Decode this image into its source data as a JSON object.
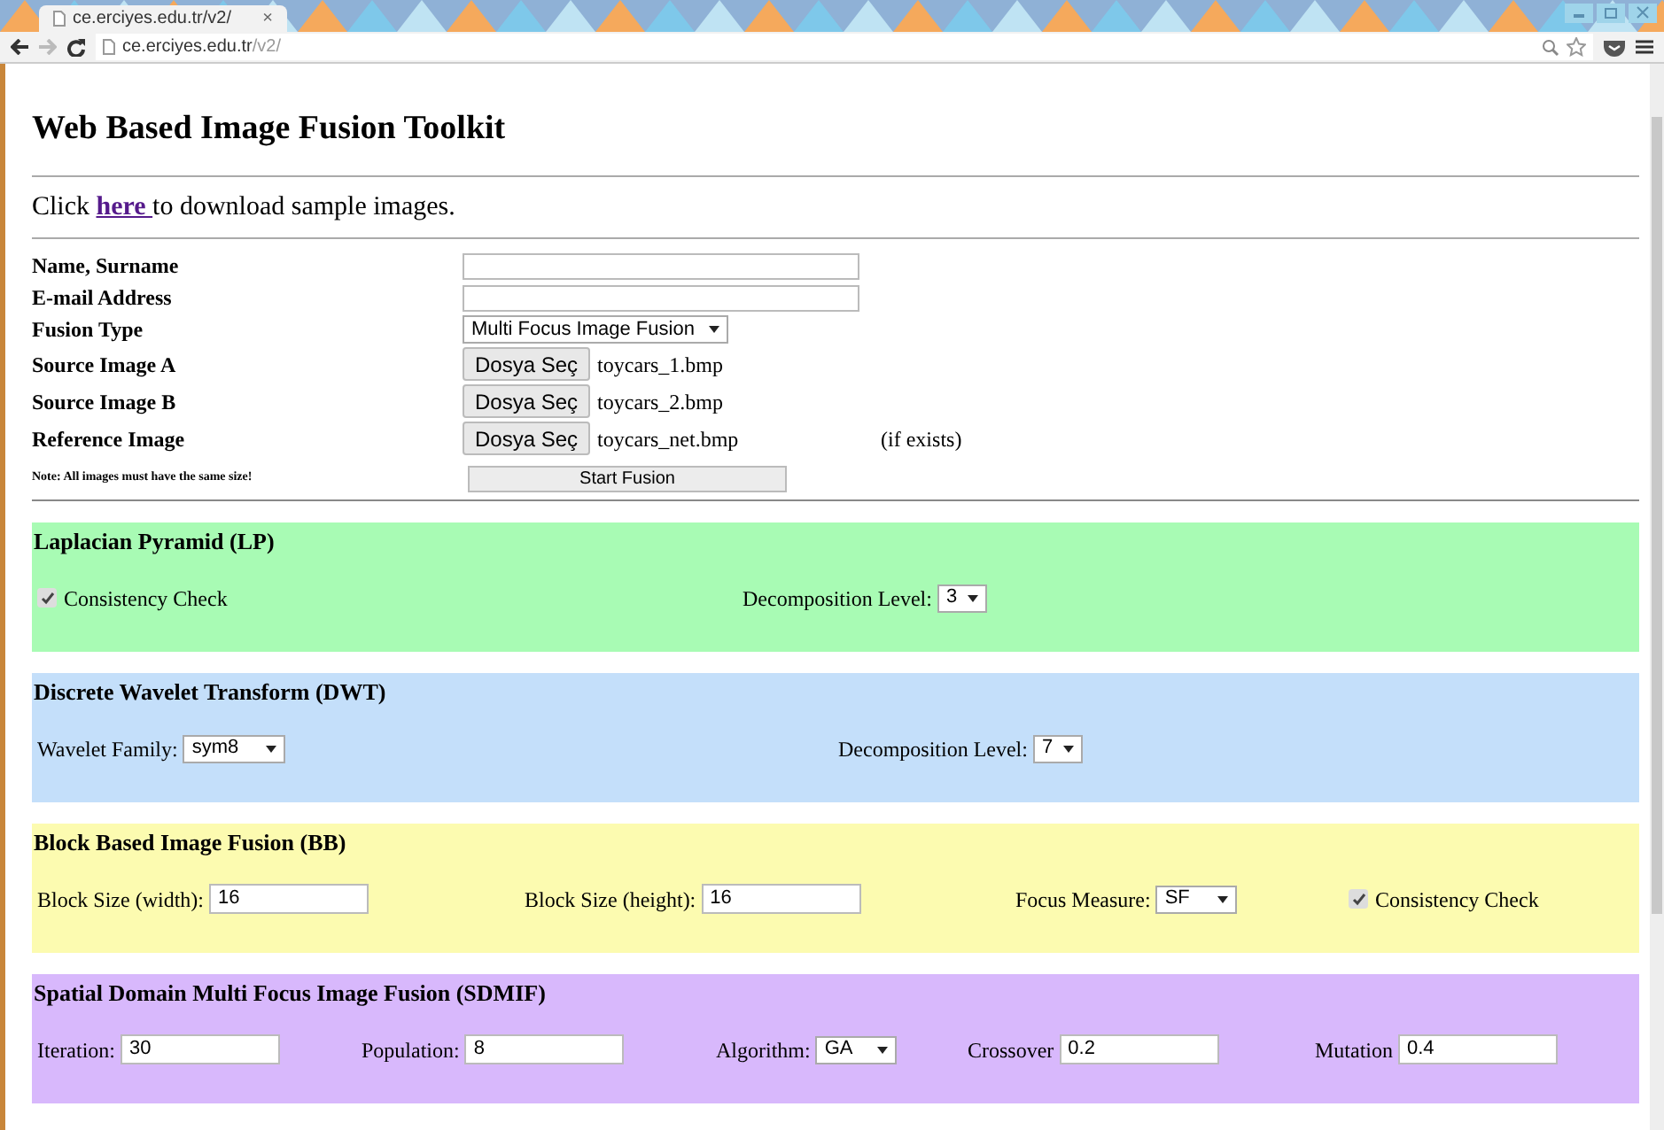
{
  "browser": {
    "tab": {
      "title": "ce.erciyes.edu.tr/v2/",
      "close": "×"
    },
    "address": {
      "host": "ce.erciyes.edu.tr",
      "path": "/v2/"
    },
    "forward_disabled": true
  },
  "page": {
    "title": "Web Based Image Fusion Toolkit",
    "intro": {
      "before": "Click ",
      "link": "here ",
      "after": "to download sample images."
    },
    "form": [
      {
        "kind": "text",
        "label": "Name, Surname"
      },
      {
        "kind": "text",
        "label": "E-mail Address"
      },
      {
        "kind": "select",
        "label": "Fusion Type",
        "value": "Multi Focus Image Fusion"
      },
      {
        "kind": "file",
        "label": "Source Image A",
        "button": "Dosya Seç",
        "file": "toycars_1.bmp"
      },
      {
        "kind": "file",
        "label": "Source Image B",
        "button": "Dosya Seç",
        "file": "toycars_2.bmp"
      },
      {
        "kind": "file",
        "label": "Reference Image",
        "button": "Dosya Seç",
        "file": "toycars_net.bmp",
        "note": "(if exists)"
      }
    ],
    "note": "Note: All images must have the same size!",
    "submit": "Start Fusion",
    "sections": [
      {
        "title": "Laplacian Pyramid (LP)",
        "color": "#a8fbb4",
        "controls": [
          {
            "kind": "checkbox",
            "label": "Consistency Check",
            "checked": true
          },
          {
            "kind": "select",
            "label": "Decomposition Level:",
            "value": "3"
          }
        ]
      },
      {
        "title": "Discrete Wavelet Transform (DWT)",
        "color": "#c4dffa",
        "controls": [
          {
            "kind": "select",
            "label": "Wavelet Family:",
            "value": "sym8"
          },
          {
            "kind": "select",
            "label": "Decomposition Level:",
            "value": "7"
          }
        ]
      },
      {
        "title": "Block Based Image Fusion (BB)",
        "color": "#fcfbb0",
        "controls": [
          {
            "kind": "text",
            "label": "Block Size (width):",
            "value": "16"
          },
          {
            "kind": "text",
            "label": "Block Size (height):",
            "value": "16"
          },
          {
            "kind": "select",
            "label": "Focus Measure:",
            "value": "SF"
          },
          {
            "kind": "checkbox",
            "label": "Consistency Check",
            "checked": true
          }
        ]
      },
      {
        "title": "Spatial Domain Multi Focus Image Fusion (SDMIF)",
        "color": "#d8b8fc",
        "controls": [
          {
            "kind": "text",
            "label": "Iteration:",
            "value": "30"
          },
          {
            "kind": "text",
            "label": "Population:",
            "value": "8"
          },
          {
            "kind": "select",
            "label": "Algorithm:",
            "value": "GA"
          },
          {
            "kind": "text",
            "label": "Crossover",
            "value": "0.2"
          },
          {
            "kind": "text",
            "label": "Mutation",
            "value": "0.4"
          }
        ]
      }
    ]
  }
}
